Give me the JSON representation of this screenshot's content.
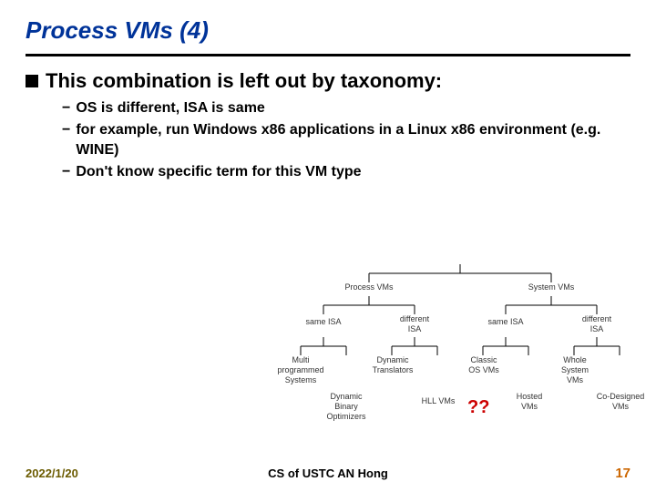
{
  "title": "Process VMs (4)",
  "main_bullet": "This combination is left out by taxonomy:",
  "subs": [
    "OS is different, ISA is same",
    "for example, run Windows x86 applications in a Linux x86 environment (e.g. WINE)",
    "Don't know specific term for this VM type"
  ],
  "question_mark": "??",
  "diagram": {
    "top_left": "Process VMs",
    "top_right": "System VMs",
    "mid": {
      "same_isa_l": "same ISA",
      "diff_isa_l": "different\nISA",
      "same_isa_r": "same ISA",
      "diff_isa_r": "different\nISA"
    },
    "bottom": {
      "b1": "Multi\nprogrammed\nSystems",
      "b2": "Dynamic\nTranslators",
      "b3": "Classic\nOS VMs",
      "b4": "Whole\nSystem VMs",
      "c1": "Dynamic\nBinary\nOptimizers",
      "c2": "HLL VMs",
      "c3": "Hosted\nVMs",
      "c4": "Co-Designed\nVMs"
    }
  },
  "footer": {
    "date": "2022/1/20",
    "center": "CS of USTC AN Hong",
    "page": "17"
  }
}
